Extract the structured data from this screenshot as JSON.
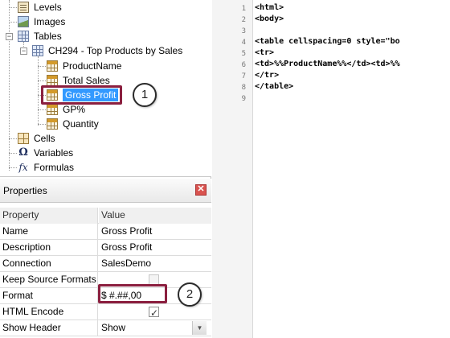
{
  "tree": {
    "items": [
      {
        "label": "Levels",
        "icon": "levels-icon"
      },
      {
        "label": "Images",
        "icon": "images-icon"
      },
      {
        "label": "Tables",
        "icon": "table-icon"
      },
      {
        "label": "CH294 - Top Products by Sales",
        "icon": "grid-icon"
      },
      {
        "label": "ProductName",
        "icon": "column-icon"
      },
      {
        "label": "Total Sales",
        "icon": "column-icon"
      },
      {
        "label": "Gross Profit",
        "icon": "column-icon"
      },
      {
        "label": "GP%",
        "icon": "column-icon"
      },
      {
        "label": "Quantity",
        "icon": "column-icon"
      },
      {
        "label": "Cells",
        "icon": "cells-icon"
      },
      {
        "label": "Variables",
        "icon": "omega-icon"
      },
      {
        "label": "Formulas",
        "icon": "fx-icon"
      }
    ],
    "selected": "Gross Profit",
    "expander_collapsed": "+",
    "expander_expanded": "−",
    "omega_glyph": "Ω",
    "fx_glyph": "fx"
  },
  "callouts": {
    "one": "1",
    "two": "2"
  },
  "properties": {
    "title": "Properties",
    "close_glyph": "✕",
    "headers": {
      "property": "Property",
      "value": "Value"
    },
    "rows": [
      {
        "name": "Name",
        "value": "Gross Profit"
      },
      {
        "name": "Description",
        "value": "Gross Profit"
      },
      {
        "name": "Connection",
        "value": "SalesDemo"
      },
      {
        "name": "Keep Source Formats",
        "value": ""
      },
      {
        "name": "Format",
        "value": "$ #.##,00"
      },
      {
        "name": "HTML Encode",
        "value": ""
      },
      {
        "name": "Show Header",
        "value": "Show"
      }
    ],
    "check_glyph": "✓",
    "dropdown_glyph": "▼"
  },
  "editor": {
    "line_numbers": [
      "1",
      "2",
      "3",
      "4",
      "5",
      "6",
      "7",
      "8",
      "9"
    ],
    "lines": [
      "<html>",
      "<body>",
      "",
      "<table cellspacing=0 style=\"bo",
      "<tr>",
      "<td>%%ProductName%%</td><td>%%",
      "</tr>",
      "</table>",
      ""
    ]
  }
}
